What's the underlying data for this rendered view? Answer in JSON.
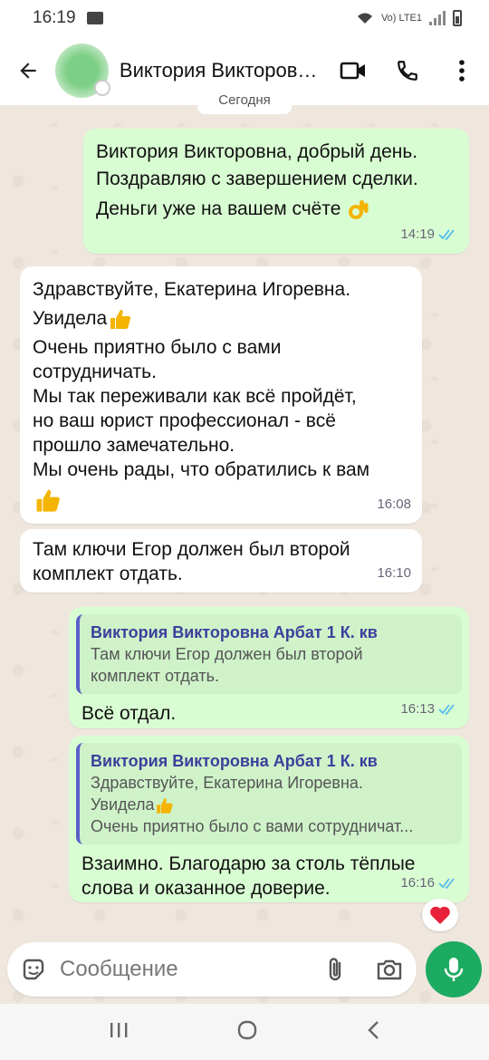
{
  "status_bar": {
    "time": "16:19",
    "network": "Vo) LTE1"
  },
  "header": {
    "contact_name": "Виктория Викторовна Арбат 1 К. кв"
  },
  "date_chip": "Сегодня",
  "messages": [
    {
      "dir": "out",
      "lines": [
        "Виктория Викторовна, добрый день.",
        "Поздравляю с завершением сделки.",
        "Деньги уже на вашем счёте"
      ],
      "time": "14:19"
    },
    {
      "dir": "in",
      "lines": [
        "Здравствуйте, Екатерина Игоревна.",
        "Увидела",
        "Очень приятно было с вами",
        "сотрудничать.",
        "Мы так переживали как всё пройдёт,",
        "но ваш юрист  профессионал - всё",
        "прошло замечательно.",
        "Мы очень рады, что обратились к вам"
      ],
      "time": "16:08"
    },
    {
      "dir": "in",
      "lines": [
        "Там ключи Егор должен был второй",
        "комплект отдать."
      ],
      "time": "16:10"
    },
    {
      "dir": "out",
      "quote_author": "Виктория Викторовна Арбат 1 К. кв",
      "quote_lines": [
        "Там ключи Егор должен был второй",
        "комплект отдать."
      ],
      "lines": [
        "Всё отдал."
      ],
      "time": "16:13"
    },
    {
      "dir": "out",
      "quote_author": "Виктория Викторовна Арбат 1 К. кв",
      "quote_lines": [
        "Здравствуйте, Екатерина Игоревна.",
        "Увидела",
        "Очень приятно было с вами сотрудничат..."
      ],
      "lines": [
        "Взаимно. Благодарю за столь тёплые",
        "слова и оказанное доверие."
      ],
      "time": "16:16",
      "reaction": "heart"
    }
  ],
  "composer": {
    "placeholder": "Сообщение"
  },
  "colors": {
    "outgoing": "#d9fdd3",
    "incoming": "#ffffff",
    "accent": "#1daa61",
    "ticks": "#53bdeb",
    "quote_bar": "#5b5fc7"
  }
}
